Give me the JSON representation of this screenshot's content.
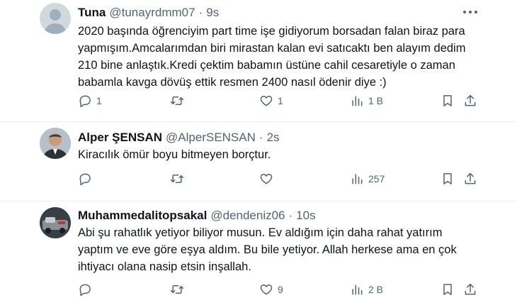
{
  "tweets": [
    {
      "name": "Tuna",
      "handle": "@tunayrdmm07",
      "time": "9s",
      "lines": [
        "2020 başında öğrenciyim part time işe gidiyorum borsadan falan biraz para",
        "yapmışım.Amcalarımdan biri mirastan kalan evi satıcaktı ben alayım dedim",
        "210 bine anlaştık.Kredi çektim babamın üstüne cahil cesaretiyle o zaman",
        "babamla kavga dövüş ettik resmen 2400 nasıl ödenir diye :)"
      ],
      "replies": "1",
      "retweets": "",
      "likes": "1",
      "views": "1 B",
      "avatar_color": "#cfd9de"
    },
    {
      "name": "Alper ŞENSAN",
      "handle": "@AlperSENSAN",
      "time": "2s",
      "lines": [
        "Kiracılık ömür boyu bitmeyen borçtur."
      ],
      "replies": "",
      "retweets": "",
      "likes": "",
      "views": "257",
      "avatar_color": "#8a8f95"
    },
    {
      "name": "Muhammedalitopsakal",
      "handle": "@dendeniz06",
      "time": "10s",
      "lines": [
        "Abi şu rahatlık yetiyor biliyor musun. Ev aldığım için daha rahat yatırım",
        "yaptım ve eve göre eşya aldım. Bu bile yetiyor. Allah herkese ama en çok",
        "ihtiyacı olana  nasip etsin inşallah."
      ],
      "replies": "",
      "retweets": "",
      "likes": "9",
      "views": "2 B",
      "avatar_color": "#4a4f57"
    }
  ],
  "icons": [
    "reply-icon",
    "retweet-icon",
    "like-icon",
    "views-icon",
    "bookmark-icon",
    "share-icon",
    "more-icon"
  ]
}
